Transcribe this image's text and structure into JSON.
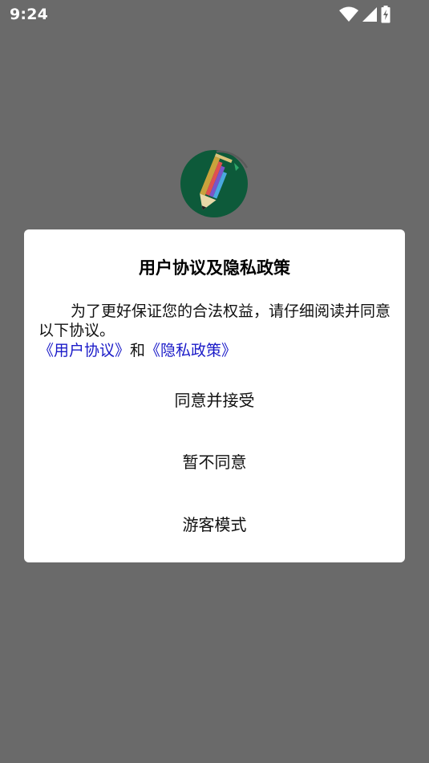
{
  "status_bar": {
    "time": "9:24",
    "icons": [
      "wifi-icon",
      "signal-icon",
      "battery-charging-icon"
    ]
  },
  "logo": {
    "icon": "pencil-app-logo",
    "background_color": "#0d5a3a"
  },
  "dialog": {
    "title": "用户协议及隐私政策",
    "body": "为了更好保证您的合法权益，请仔细阅读并同意以下协议。",
    "user_agreement_link": "《用户协议》",
    "conjunction": "和",
    "privacy_policy_link": "《隐私政策》",
    "link_color": "#1a1ac8",
    "buttons": {
      "agree": "同意并接受",
      "disagree": "暂不同意",
      "guest": "游客模式"
    }
  }
}
